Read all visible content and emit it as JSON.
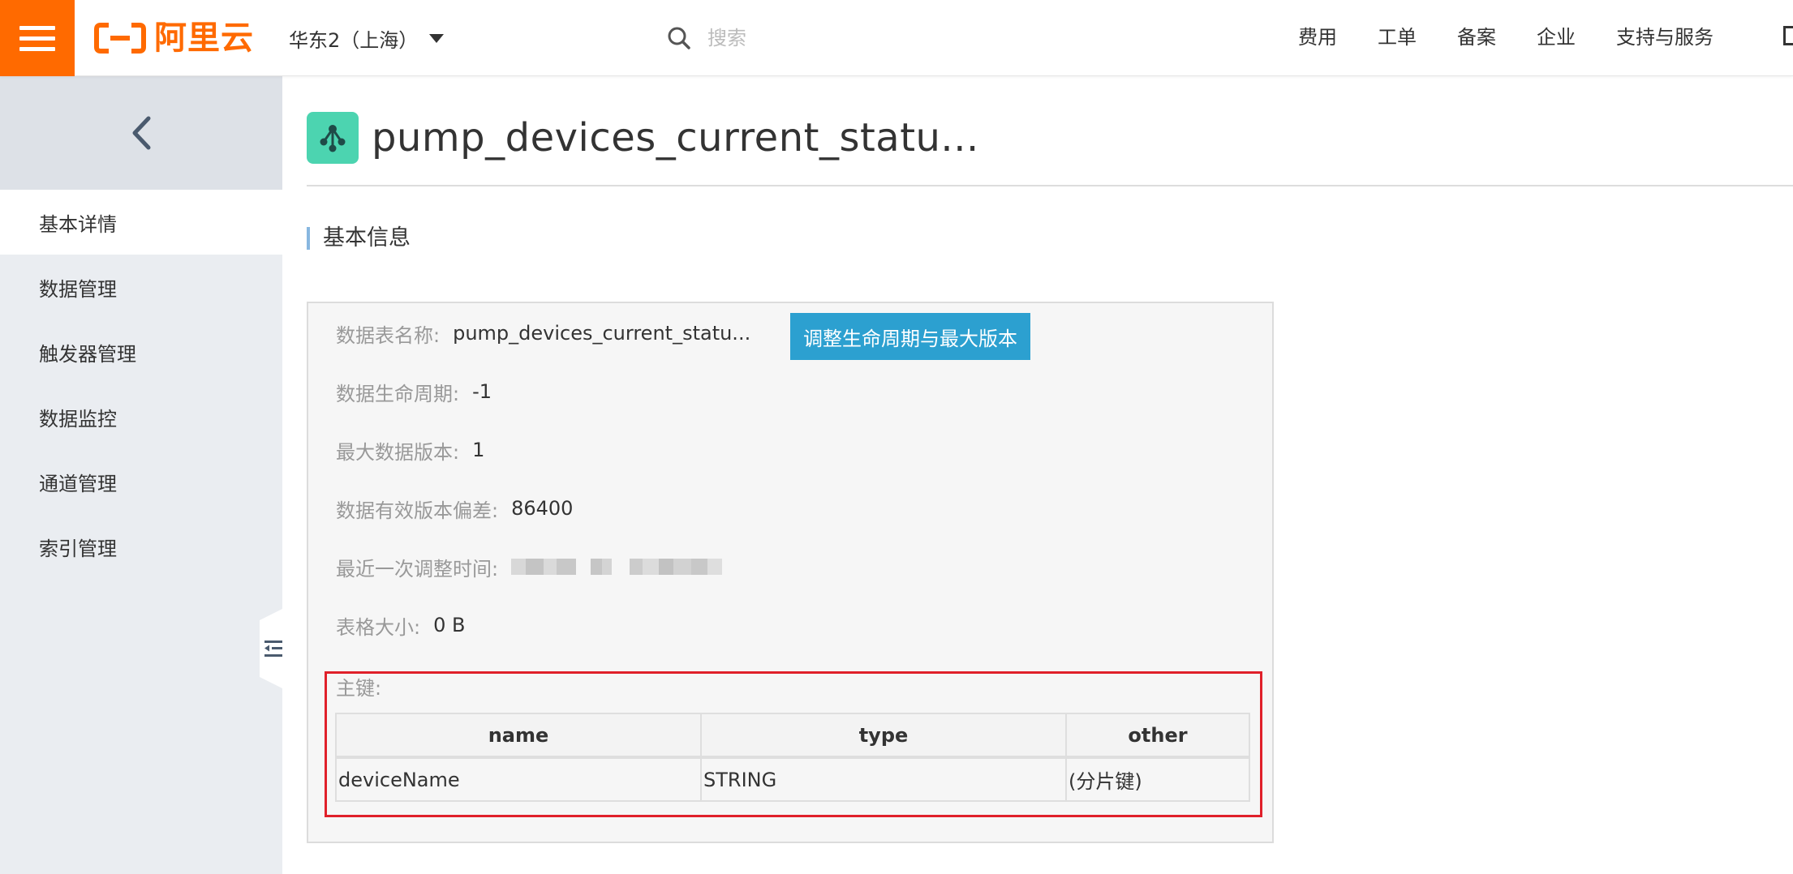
{
  "header": {
    "logo_text": "阿里云",
    "region": "华东2（上海）",
    "search_placeholder": "搜索",
    "nav": [
      "费用",
      "工单",
      "备案",
      "企业",
      "支持与服务"
    ]
  },
  "sidebar": {
    "items": [
      {
        "label": "基本详情",
        "active": true
      },
      {
        "label": "数据管理",
        "active": false
      },
      {
        "label": "触发器管理",
        "active": false
      },
      {
        "label": "数据监控",
        "active": false
      },
      {
        "label": "通道管理",
        "active": false
      },
      {
        "label": "索引管理",
        "active": false
      }
    ]
  },
  "page": {
    "title": "pump_devices_current_statu...",
    "section_title": "基本信息"
  },
  "info": {
    "table_name_label": "数据表名称:",
    "table_name_value": "pump_devices_current_statu...",
    "ttl_label": "数据生命周期:",
    "ttl_value": "-1",
    "max_versions_label": "最大数据版本:",
    "max_versions_value": "1",
    "deviation_label": "数据有效版本偏差:",
    "deviation_value": "86400",
    "last_modified_label": "最近一次调整时间:",
    "table_size_label": "表格大小:",
    "table_size_value": "0 B",
    "adjust_button": "调整生命周期与最大版本",
    "primary_key_label": "主键:"
  },
  "primary_key_table": {
    "headers": [
      "name",
      "type",
      "other"
    ],
    "rows": [
      [
        "deviceName",
        "STRING",
        "(分片键)"
      ]
    ]
  },
  "colors": {
    "brand": "#ff6a00",
    "button": "#2ca0d0",
    "highlight_border": "#e0202a",
    "title_icon": "#4cd4b0"
  },
  "icons": [
    "menu-icon",
    "search-icon",
    "chevron-down-icon",
    "back-arrow-icon",
    "collapse-sidebar-icon",
    "table-store-icon"
  ]
}
